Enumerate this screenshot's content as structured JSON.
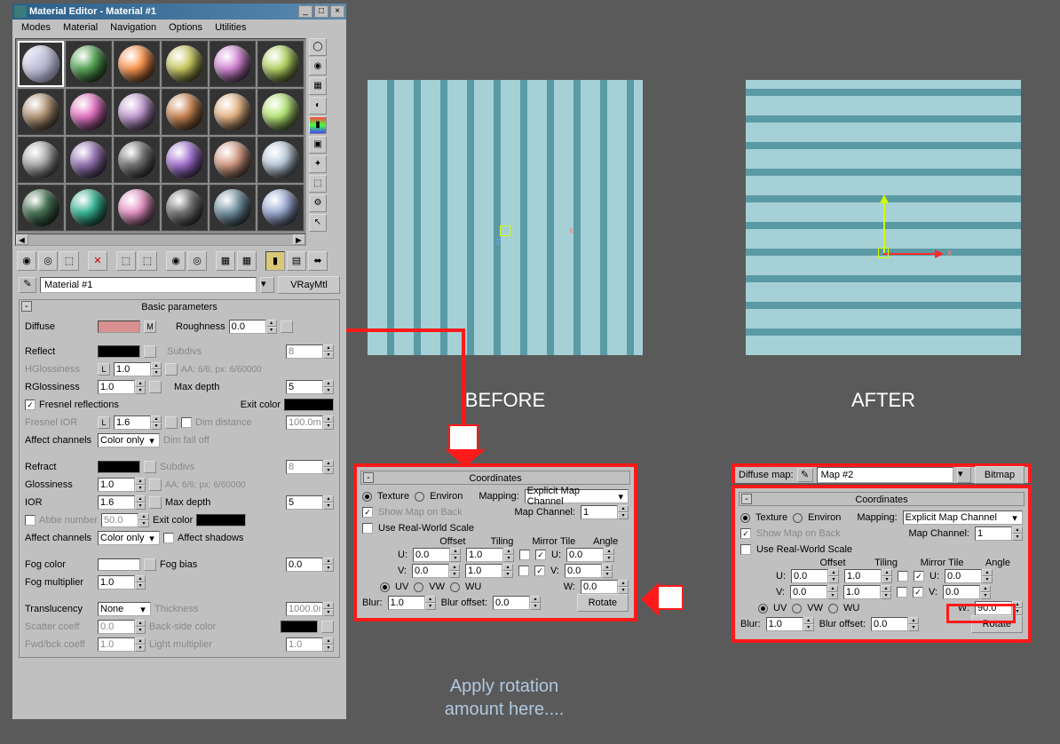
{
  "window": {
    "title": "Material Editor - Material #1",
    "menus": [
      "Modes",
      "Material",
      "Navigation",
      "Options",
      "Utilities"
    ]
  },
  "samples": {
    "colors": [
      "linear-gradient(135deg,#eef,#99b)",
      "#5aaa5a",
      "#ff9955",
      "#cccc66",
      "#d88bd8",
      "#b8d868",
      "#b89a7a",
      "#e878c8",
      "#c8a0d8",
      "#cc8855",
      "#e8b888",
      "#b8e878",
      "#b0b0b0",
      "#9a78b8",
      "#787878",
      "#a878d8",
      "#d8a088",
      "#c0d0e0",
      "#4a7858",
      "#3ab898",
      "#e898c8",
      "#787878",
      "#7898a8",
      "#a0b0d8"
    ]
  },
  "nameRow": {
    "value": "Material #1",
    "typeBtn": "VRayMtl"
  },
  "rollouts": {
    "basic": {
      "title": "Basic parameters",
      "diffuse": "Diffuse",
      "roughness": "Roughness",
      "roughnessVal": "0.0",
      "reflect": "Reflect",
      "subdivs": "Subdivs",
      "subdivsVal": "8",
      "hgloss": "HGlossiness",
      "hglossVal": "1.0",
      "aaHint": "AA: 6/6; px: 6/60000",
      "rgloss": "RGlossiness",
      "rglossVal": "1.0",
      "maxDepth": "Max depth",
      "maxDepthVal": "5",
      "fresnel": "Fresnel reflections",
      "exitColor": "Exit color",
      "fresnelIOR": "Fresnel IOR",
      "fresnelIORVal": "1.6",
      "dimDist": "Dim distance",
      "dimDistVal": "100.0m",
      "affectCh": "Affect channels",
      "affectChVal": "Color only",
      "dimFall": "Dim fall off",
      "refract": "Refract",
      "refrSubdivsVal": "8",
      "glossiness": "Glossiness",
      "glossinessVal": "1.0",
      "ior": "IOR",
      "iorVal": "1.6",
      "refrMaxDepthVal": "5",
      "abbe": "Abbe number",
      "abbeVal": "50.0",
      "affectCh2Val": "Color only",
      "affectShadows": "Affect shadows",
      "fogColor": "Fog color",
      "fogBias": "Fog bias",
      "fogBiasVal": "0.0",
      "fogMult": "Fog multiplier",
      "fogMultVal": "1.0",
      "translucency": "Translucency",
      "transVal": "None",
      "thickness": "Thickness",
      "thickVal": "1000.0m",
      "scatter": "Scatter coeff",
      "scatterVal": "0.0",
      "backSide": "Back-side color",
      "fwdBck": "Fwd/bck coeff",
      "fwdBckVal": "1.0",
      "lightMult": "Light multiplier",
      "lightMultVal": "1.0"
    }
  },
  "labels": {
    "before": "BEFORE",
    "after": "AFTER"
  },
  "coords": {
    "title": "Coordinates",
    "texture": "Texture",
    "environ": "Environ",
    "mapping": "Mapping:",
    "mappingVal": "Explicit Map Channel",
    "showMapBack": "Show Map on Back",
    "mapChannel": "Map Channel:",
    "mapChannelVal": "1",
    "realWorld": "Use Real-World Scale",
    "offset": "Offset",
    "tiling": "Tiling",
    "mirrorTile": "Mirror Tile",
    "angle": "Angle",
    "u": "U:",
    "v": "V:",
    "w": "W:",
    "uOff": "0.0",
    "vOff": "0.0",
    "uTile": "1.0",
    "vTile": "1.0",
    "uAng": "0.0",
    "vAng": "0.0",
    "wAngL": "0.0",
    "wAngR": "90.0",
    "uv": "UV",
    "vw": "VW",
    "wu": "WU",
    "blur": "Blur:",
    "blurVal": "1.0",
    "blurOff": "Blur offset:",
    "blurOffVal": "0.0",
    "rotate": "Rotate"
  },
  "diffuseMap": {
    "label": "Diffuse map:",
    "name": "Map #2",
    "type": "Bitmap"
  },
  "annotation": "Apply rotation\namount here...."
}
